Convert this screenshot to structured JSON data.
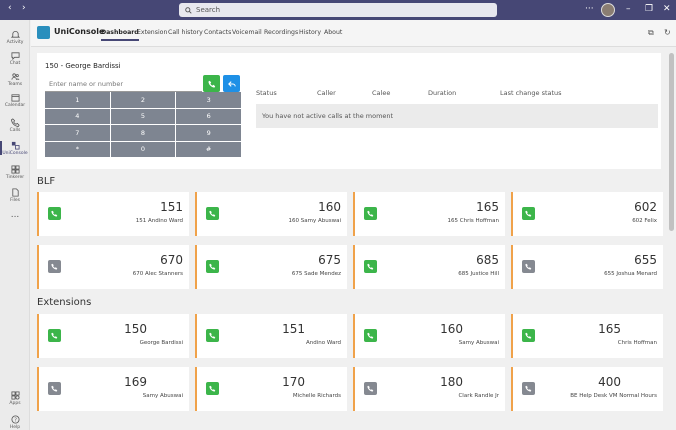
{
  "titlebar": {
    "back": "‹",
    "forward": "›",
    "search_placeholder": "Search",
    "more": "···",
    "minimize": "–",
    "maximize": "❐",
    "close": "✕"
  },
  "rail": [
    {
      "label": "Activity",
      "icon": "bell-icon"
    },
    {
      "label": "Chat",
      "icon": "chat-icon"
    },
    {
      "label": "Teams",
      "icon": "teams-icon"
    },
    {
      "label": "Calendar",
      "icon": "calendar-icon"
    },
    {
      "label": "Calls",
      "icon": "phone-icon"
    },
    {
      "label": "UniConsole",
      "icon": "uniconsole-icon"
    },
    {
      "label": "Tinkerer",
      "icon": "tinkerer-icon"
    },
    {
      "label": "Files",
      "icon": "files-icon"
    },
    {
      "label": "...",
      "icon": "more-icon"
    },
    {
      "label": "Apps",
      "icon": "apps-icon"
    },
    {
      "label": "Help",
      "icon": "help-icon"
    }
  ],
  "app": {
    "name": "UniConsole",
    "tabs": [
      "Dashboard",
      "Extension",
      "Call history",
      "Contacts",
      "Voicemail",
      "Recordings",
      "History",
      "About"
    ],
    "active_tab": "Dashboard"
  },
  "dialer": {
    "title": "150 - George Bardissi",
    "input_placeholder": "Enter name or number",
    "keys": [
      "1",
      "2",
      "3",
      "4",
      "5",
      "6",
      "7",
      "8",
      "9",
      "*",
      "0",
      "#"
    ]
  },
  "calls": {
    "headers": [
      "Status",
      "Caller",
      "Calee",
      "Duration",
      "Last change status"
    ],
    "empty_message": "You have not active calls at the moment"
  },
  "blf": {
    "title": "BLF",
    "items": [
      {
        "number": "151",
        "name": "151 Andino Ward",
        "state": "green"
      },
      {
        "number": "160",
        "name": "160 Samy Abuswai",
        "state": "green"
      },
      {
        "number": "165",
        "name": "165 Chris Hoffman",
        "state": "green"
      },
      {
        "number": "602",
        "name": "602 Felix",
        "state": "green"
      },
      {
        "number": "670",
        "name": "670 Alec Stanners",
        "state": "gray"
      },
      {
        "number": "675",
        "name": "675 Sade Mendez",
        "state": "green"
      },
      {
        "number": "685",
        "name": "685 Justice Hill",
        "state": "green"
      },
      {
        "number": "655",
        "name": "655 Joshua Menard",
        "state": "gray"
      }
    ]
  },
  "extensions": {
    "title": "Extensions",
    "items": [
      {
        "number": "150",
        "name": "George Bardissi",
        "state": "green"
      },
      {
        "number": "151",
        "name": "Andino Ward",
        "state": "green"
      },
      {
        "number": "160",
        "name": "Samy Abuswai",
        "state": "green"
      },
      {
        "number": "165",
        "name": "Chris Hoffman",
        "state": "green"
      },
      {
        "number": "169",
        "name": "Samy Abuswai",
        "state": "gray"
      },
      {
        "number": "170",
        "name": "Michelle Richards",
        "state": "green"
      },
      {
        "number": "180",
        "name": "Clark Randle Jr",
        "state": "gray"
      },
      {
        "number": "400",
        "name": "BE Help Desk VM Normal Hours",
        "state": "gray"
      }
    ]
  },
  "colors": {
    "accent": "#464775",
    "status_green": "#3cb54a",
    "status_gray": "#858991",
    "tile_border": "#f0a24a",
    "call_button": "#3cb54a",
    "transfer_button": "#1e90e6"
  }
}
